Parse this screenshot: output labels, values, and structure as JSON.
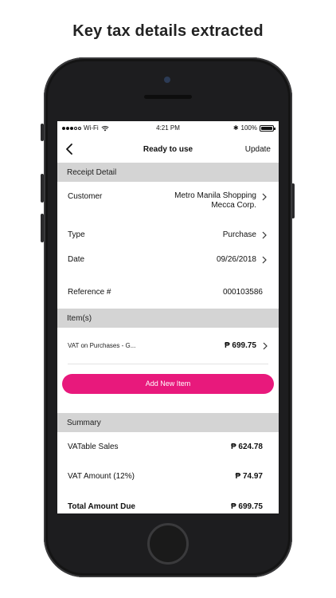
{
  "headline": "Key tax details extracted",
  "status_bar": {
    "carrier": "Wi-Fi",
    "time": "4:21 PM",
    "battery": "100%"
  },
  "nav": {
    "title": "Ready to use",
    "update_label": "Update",
    "back_icon": "chevron-left-icon"
  },
  "receipt_detail": {
    "header": "Receipt Detail",
    "customer_label": "Customer",
    "customer_value": "Metro Manila Shopping Mecca Corp.",
    "type_label": "Type",
    "type_value": "Purchase",
    "date_label": "Date",
    "date_value": "09/26/2018",
    "reference_label": "Reference #",
    "reference_value": "000103586"
  },
  "items": {
    "header": "Item(s)",
    "list": [
      {
        "name": "VAT on Purchases - G...",
        "amount": "₱ 699.75"
      }
    ],
    "add_label": "Add New Item"
  },
  "summary": {
    "header": "Summary",
    "vatable_label": "VATable Sales",
    "vatable_value": "₱ 624.78",
    "vat_label": "VAT Amount (12%)",
    "vat_value": "₱ 74.97",
    "total_label": "Total Amount Due",
    "total_value": "₱ 699.75"
  },
  "colors": {
    "accent": "#e8197c",
    "section_bg": "#d4d4d4",
    "phone_body": "#1d1d1f"
  }
}
